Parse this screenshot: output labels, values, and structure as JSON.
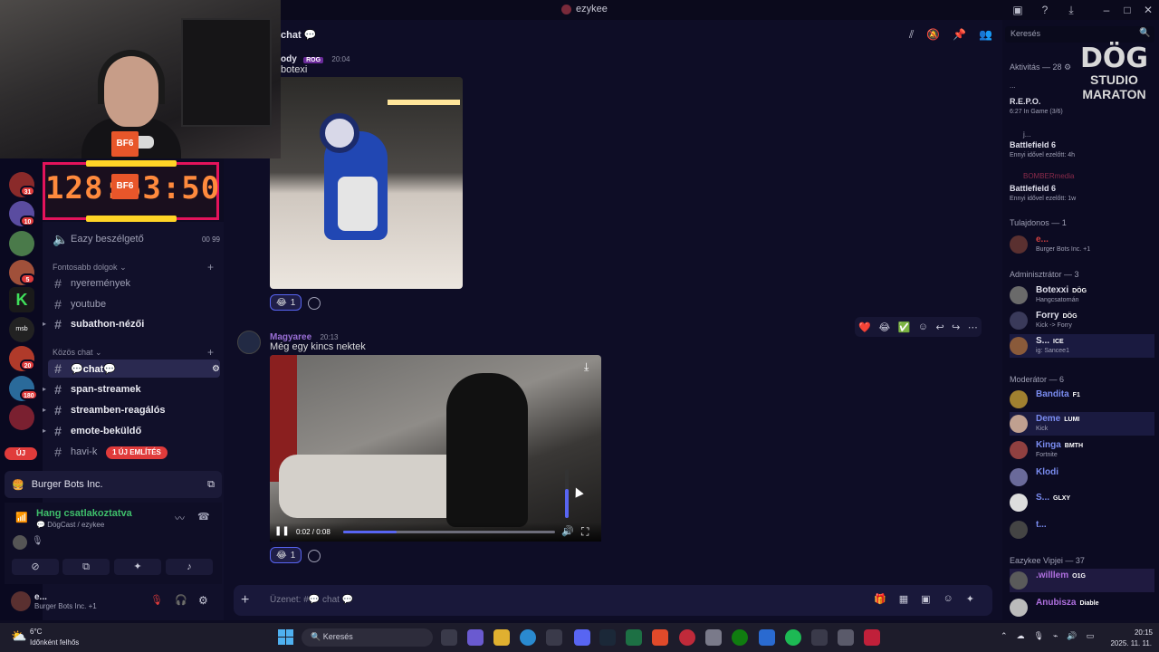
{
  "titlebar": {
    "title": "ezykee"
  },
  "timer": {
    "value": "128:53:50"
  },
  "rail": {
    "badges": [
      "31",
      "10",
      "5",
      "20",
      "180",
      "8"
    ],
    "uj": "ÚJ"
  },
  "sidebar": {
    "voice_channel": "Eazy beszélgető",
    "voice_counts": "00  99",
    "cat_fontos": "Fontosabb dolgok",
    "cat_kozos": "Közös chat",
    "channels": [
      {
        "name": "nyeremények"
      },
      {
        "name": "youtube"
      },
      {
        "name": "subathon-nézői"
      },
      {
        "name": "chat"
      },
      {
        "name": "span-streamek"
      },
      {
        "name": "streamben-reagálós"
      },
      {
        "name": "emote-beküldő"
      },
      {
        "name": "havi-k"
      }
    ],
    "mention_badge": "1 ÚJ EMLÍTÉS",
    "server_name": "Burger Bots Inc.",
    "voice_status": "Hang csatlakoztatva",
    "voice_sub": "DögCast / ezykee",
    "user_name": "e...",
    "user_sub": "Burger Bots Inc. +1"
  },
  "chat": {
    "header": "chat",
    "msg1": {
      "author": "ody",
      "tag": "ROG",
      "time": "20:04",
      "text": "botexi",
      "reaction_count": "1"
    },
    "msg2": {
      "author": "Magyaree",
      "time": "20:13",
      "text": "Még egy kincs nektek",
      "reaction_count": "1"
    },
    "video": {
      "time": "0:02 / 0:08",
      "progress": 0.25,
      "volume": 0.6
    },
    "composer_placeholder": "Üzenet: #",
    "composer_channel": "chat"
  },
  "members": {
    "search_placeholder": "Keresés",
    "logo_l1": "DÖG",
    "logo_l2": "STUDIO",
    "logo_l3": "MARATON",
    "sections": {
      "activity": "Aktivitás — 28",
      "owner": "Tulajdonos — 1",
      "admin": "Adminisztrátor — 3",
      "mod": "Moderátor — 6",
      "vip": "Eazykee Vipjei — 37"
    },
    "activity": [
      {
        "name": "R.E.P.O.",
        "sub": "6:27  In Game (3/6)"
      },
      {
        "name": "Battlefield 6",
        "sub": "Ennyi idővel ezelőtt: 4h"
      },
      {
        "name": "Battlefield 6",
        "sub": "Ennyi idővel ezelőtt: 1w"
      }
    ],
    "activity_users": [
      "j...",
      "BOMBERmedia"
    ],
    "bf_label": "BF6",
    "owner": [
      {
        "name": "e...",
        "sub": "Burger Bots Inc. +1"
      }
    ],
    "admin": [
      {
        "name": "Botexxi",
        "tag": "DÖG",
        "sub": "Hangcsatornán"
      },
      {
        "name": "Forry",
        "tag": "DÖG",
        "sub": "Kick -> Forry"
      },
      {
        "name": "S...",
        "tag": "ICE",
        "sub": "ig: Sancee1"
      }
    ],
    "mod": [
      {
        "name": "Bandita",
        "tag": "F1",
        "sub": ""
      },
      {
        "name": "Deme",
        "tag": "LUMI",
        "sub": "Kick"
      },
      {
        "name": "Kinga",
        "tag": "BMTH",
        "sub": "Fortnite"
      },
      {
        "name": "Klodi",
        "tag": "",
        "sub": ""
      },
      {
        "name": "S...",
        "tag": "GLXY",
        "sub": ""
      },
      {
        "name": "t...",
        "tag": "",
        "sub": ""
      }
    ],
    "vip": [
      {
        "name": ".willlem",
        "tag": "O1G",
        "sub": ""
      },
      {
        "name": "Anubisza",
        "tag": "Diable",
        "sub": ""
      }
    ]
  },
  "taskbar": {
    "temp": "6°C",
    "weather": "Időnként felhős",
    "search": "Keresés",
    "time": "20:15",
    "date": "2025. 11. 11."
  },
  "colors": {
    "accent": "#5865f2",
    "danger": "#e03b3b",
    "online": "#3fbf6b",
    "timer_border": "#e4135b",
    "timer_text": "#ff8a3d"
  }
}
